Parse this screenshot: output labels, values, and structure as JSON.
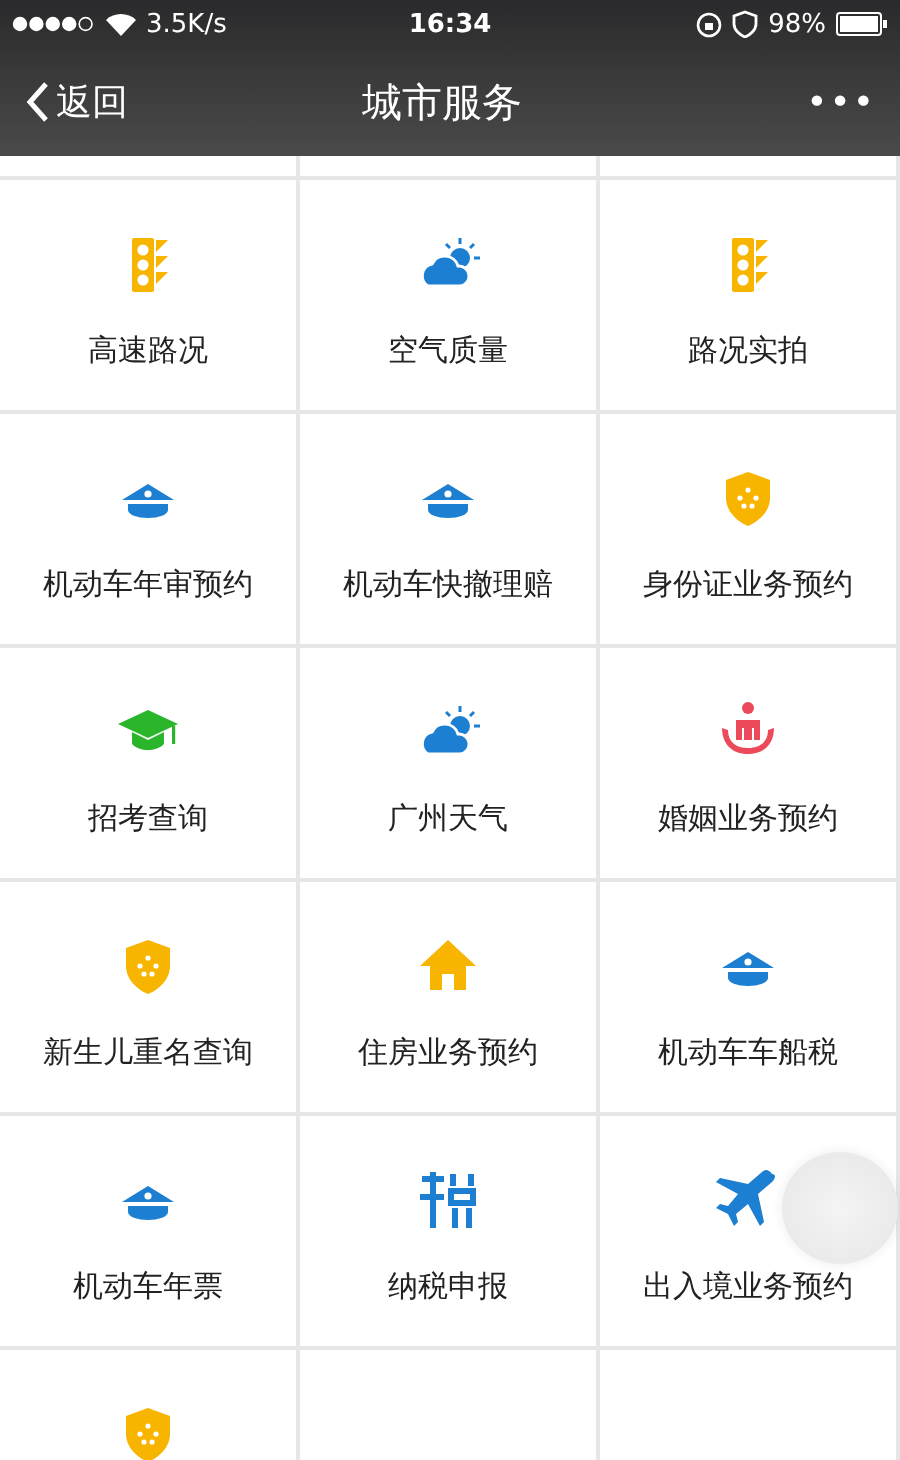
{
  "status_bar": {
    "speed": "3.5K/s",
    "time": "16:34",
    "battery": "98%"
  },
  "nav": {
    "back": "返回",
    "title": "城市服务",
    "more": "•••"
  },
  "services": [
    {
      "kind": "traffic",
      "label": "高速路况"
    },
    {
      "kind": "weather",
      "label": "空气质量"
    },
    {
      "kind": "traffic",
      "label": "路况实拍"
    },
    {
      "kind": "police",
      "label": "机动车年审预约"
    },
    {
      "kind": "police",
      "label": "机动车快撤理赔"
    },
    {
      "kind": "shield",
      "label": "身份证业务预约"
    },
    {
      "kind": "graduation",
      "label": "招考查询"
    },
    {
      "kind": "weather",
      "label": "广州天气"
    },
    {
      "kind": "marriage",
      "label": "婚姻业务预约"
    },
    {
      "kind": "shield",
      "label": "新生儿重名查询"
    },
    {
      "kind": "house",
      "label": "住房业务预约"
    },
    {
      "kind": "police",
      "label": "机动车车船税"
    },
    {
      "kind": "police",
      "label": "机动车年票"
    },
    {
      "kind": "tax",
      "label": "纳税申报"
    },
    {
      "kind": "plane",
      "label": "出入境业务预约"
    },
    {
      "kind": "shield"
    },
    {
      "kind": "empty"
    },
    {
      "kind": "empty"
    }
  ]
}
